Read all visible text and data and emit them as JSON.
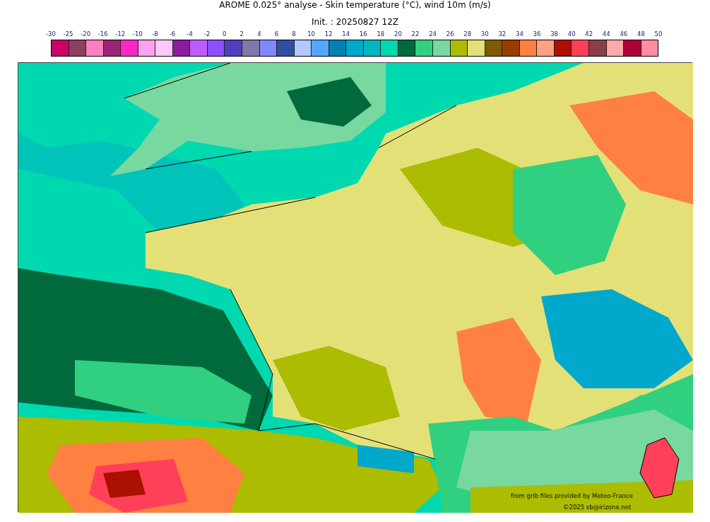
{
  "title": "AROME 0.025° analyse - Skin temperature (°C), wind 10m (m/s)",
  "subtitle": "Init. : 20250827 12Z",
  "colorbar": {
    "ticks": [
      "-30",
      "-25",
      "-20",
      "-16",
      "-12",
      "-10",
      "-8",
      "-6",
      "-4",
      "-2",
      "0",
      "2",
      "4",
      "6",
      "8",
      "10",
      "12",
      "14",
      "16",
      "18",
      "20",
      "22",
      "24",
      "26",
      "28",
      "30",
      "32",
      "34",
      "36",
      "38",
      "40",
      "42",
      "44",
      "46",
      "48",
      "50"
    ],
    "bins": [
      {
        "color": "#cc0066"
      },
      {
        "color": "#8b4060"
      },
      {
        "color": "#ff80c0"
      },
      {
        "color": "#9a2678"
      },
      {
        "color": "#ff26c8"
      },
      {
        "color": "#ffa0f0"
      },
      {
        "color": "#ffc8ff"
      },
      {
        "color": "#8c1c9c"
      },
      {
        "color": "#bf5cff"
      },
      {
        "color": "#8c50ff"
      },
      {
        "color": "#4f40c0"
      },
      {
        "color": "#8078a8"
      },
      {
        "color": "#8088ff"
      },
      {
        "color": "#2e50a0"
      },
      {
        "color": "#b0c8ff"
      },
      {
        "color": "#50a8ff"
      },
      {
        "color": "#0080b4"
      },
      {
        "color": "#00a8cc"
      },
      {
        "color": "#00b8c0"
      },
      {
        "color": "#00d8b0"
      },
      {
        "color": "#006a3c"
      },
      {
        "color": "#30d080"
      },
      {
        "color": "#78d8a0"
      },
      {
        "color": "#acbc00"
      },
      {
        "color": "#e4e078"
      },
      {
        "color": "#7f5a00"
      },
      {
        "color": "#983c00"
      },
      {
        "color": "#ff8040"
      },
      {
        "color": "#ffa080"
      },
      {
        "color": "#ac1000"
      },
      {
        "color": "#ff4058"
      },
      {
        "color": "#8b4048"
      },
      {
        "color": "#ffa8a8"
      },
      {
        "color": "#b00038"
      },
      {
        "color": "#ff8ca0"
      }
    ]
  },
  "credits": [
    "from grib files provided by Meteo-France",
    "©2025 sb@irizone.net"
  ]
}
